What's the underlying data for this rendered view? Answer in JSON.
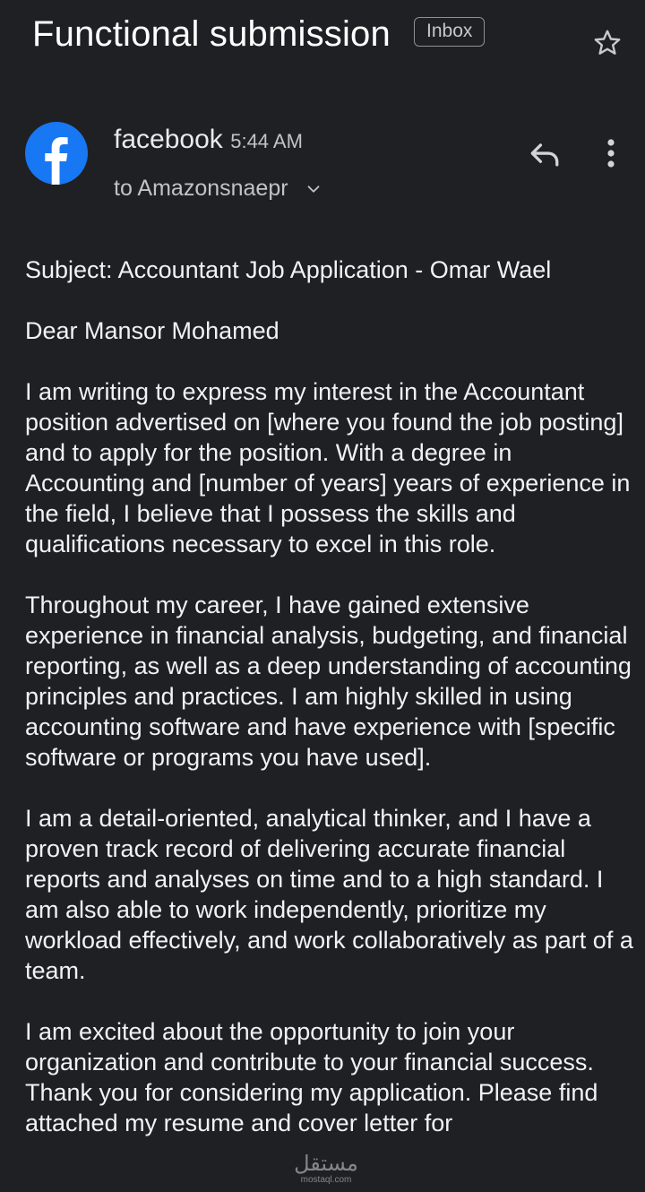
{
  "header": {
    "subject": "Functional submission",
    "label": "Inbox",
    "star_icon": "star-outline-icon"
  },
  "sender": {
    "name": "facebook",
    "time": "5:44 AM",
    "recipient": "to Amazonsnaepr",
    "avatar_icon": "facebook-logo-icon",
    "avatar_color": "#1877f2",
    "reply_icon": "reply-icon",
    "more_icon": "more-vertical-icon"
  },
  "body": {
    "paragraphs": [
      "Subject: Accountant Job Application - Omar Wael",
      "Dear Mansor Mohamed",
      "I am writing to express my interest in the Accountant position advertised on [where you found the job posting] and to apply for the position. With a degree in Accounting and [number of years] years of experience in the field, I believe that I possess the skills and qualifications necessary to excel in this role.",
      "Throughout my career, I have gained extensive experience in financial analysis, budgeting, and financial reporting, as well as a deep understanding of accounting principles and practices. I am highly skilled in using accounting software and have experience with [specific software or programs you have used].",
      "I am a detail-oriented, analytical thinker, and I have a proven track record of delivering accurate financial reports and analyses on time and to a high standard. I am also able to work independently, prioritize my workload effectively, and work collaboratively as part of a team.",
      "I am excited about the opportunity to join your organization and contribute to your financial success. Thank you for considering my application. Please find attached my resume and cover letter for"
    ]
  },
  "watermark": {
    "main": "مستقل",
    "sub": "mostaql.com"
  },
  "colors": {
    "background": "#1f2023",
    "text": "#f1f2f4",
    "secondary_text": "#c0c3c7",
    "chip_border": "#8c8f94"
  }
}
